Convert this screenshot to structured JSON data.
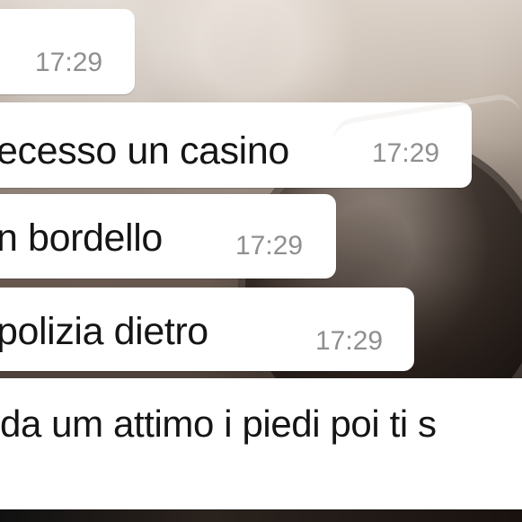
{
  "chat": {
    "messages": [
      {
        "text": "",
        "time": "17:29"
      },
      {
        "text": "ecesso un casino",
        "time": "17:29"
      },
      {
        "text": "n bordello",
        "time": "17:29"
      },
      {
        "text": "polizia dietro",
        "time": "17:29"
      },
      {
        "text": "da um attimo i piedi poi ti s",
        "time": ""
      }
    ]
  },
  "colors": {
    "bubble_background": "#ffffff",
    "message_text": "#151515",
    "timestamp_text": "#8f8f8f",
    "chat_background": "#6f625a"
  }
}
